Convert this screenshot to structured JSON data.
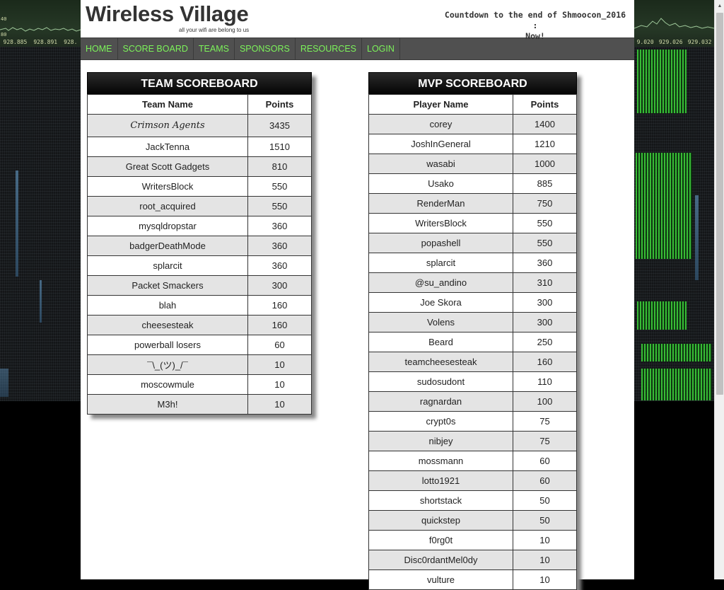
{
  "header": {
    "logo": "Wireless Village",
    "tagline": "all your wifi are belong to us",
    "countdown_line1": "Countdown to the end of Shmoocon_2016 :",
    "countdown_line2": "Now!"
  },
  "nav": [
    "HOME",
    "SCORE BOARD",
    "TEAMS",
    "SPONSORS",
    "RESOURCES",
    "LOGIN"
  ],
  "spectrum": {
    "left_freqs": [
      "928.885",
      "928.891",
      "928."
    ],
    "right_freqs": [
      "9.020",
      "929.026",
      "929.032"
    ],
    "left_axis": [
      "40",
      "80"
    ]
  },
  "team_board": {
    "title": "TEAM SCOREBOARD",
    "col_name": "Team Name",
    "col_points": "Points",
    "rows": [
      {
        "name": "Crimson Agents",
        "points": "3435"
      },
      {
        "name": "JackTenna",
        "points": "1510"
      },
      {
        "name": "Great Scott Gadgets",
        "points": "810"
      },
      {
        "name": "WritersBlock",
        "points": "550"
      },
      {
        "name": "root_acquired",
        "points": "550"
      },
      {
        "name": "mysqldropstar",
        "points": "360"
      },
      {
        "name": "badgerDeathMode",
        "points": "360"
      },
      {
        "name": "splarcit",
        "points": "360"
      },
      {
        "name": "Packet Smackers",
        "points": "300"
      },
      {
        "name": "blah",
        "points": "160"
      },
      {
        "name": "cheesesteak",
        "points": "160"
      },
      {
        "name": "powerball losers",
        "points": "60"
      },
      {
        "name": "¯\\_(ツ)_/¯",
        "points": "10"
      },
      {
        "name": "moscowmule",
        "points": "10"
      },
      {
        "name": "M3h!",
        "points": "10"
      }
    ]
  },
  "mvp_board": {
    "title": "MVP SCOREBOARD",
    "col_name": "Player Name",
    "col_points": "Points",
    "rows": [
      {
        "name": "corey",
        "points": "1400"
      },
      {
        "name": "JoshInGeneral",
        "points": "1210"
      },
      {
        "name": "wasabi",
        "points": "1000"
      },
      {
        "name": "Usako",
        "points": "885"
      },
      {
        "name": "RenderMan",
        "points": "750"
      },
      {
        "name": "WritersBlock",
        "points": "550"
      },
      {
        "name": "popashell",
        "points": "550"
      },
      {
        "name": "splarcit",
        "points": "360"
      },
      {
        "name": "@su_andino",
        "points": "310"
      },
      {
        "name": "Joe Skora",
        "points": "300"
      },
      {
        "name": "Volens",
        "points": "300"
      },
      {
        "name": "Beard",
        "points": "250"
      },
      {
        "name": "teamcheesesteak",
        "points": "160"
      },
      {
        "name": "sudosudont",
        "points": "110"
      },
      {
        "name": "ragnardan",
        "points": "100"
      },
      {
        "name": "crypt0s",
        "points": "75"
      },
      {
        "name": "nibjey",
        "points": "75"
      },
      {
        "name": "mossmann",
        "points": "60"
      },
      {
        "name": "lotto1921",
        "points": "60"
      },
      {
        "name": "shortstack",
        "points": "50"
      },
      {
        "name": "quickstep",
        "points": "50"
      },
      {
        "name": "f0rg0t",
        "points": "10"
      },
      {
        "name": "Disc0rdantMel0dy",
        "points": "10"
      },
      {
        "name": "vulture",
        "points": "10"
      }
    ]
  }
}
